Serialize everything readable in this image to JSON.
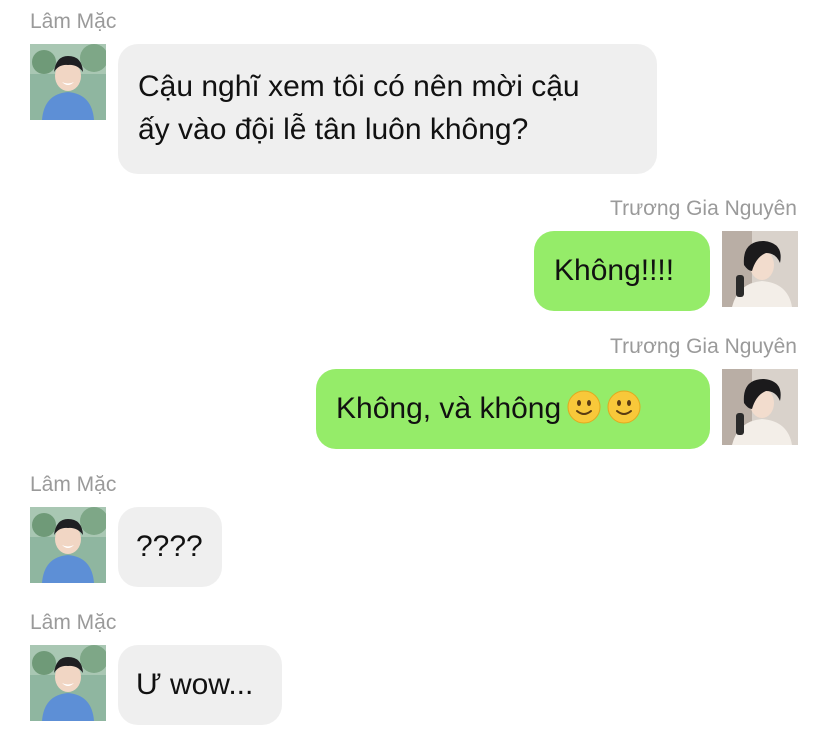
{
  "messages": [
    {
      "id": "m1",
      "direction": "in",
      "sender": "Lâm Mặc",
      "text": "Cậu nghĩ xem tôi có nên mời cậu\nấy vào đội lễ tân luôn không?"
    },
    {
      "id": "m2",
      "direction": "out",
      "sender": "Trương Gia Nguyên",
      "text": "Không!!!!"
    },
    {
      "id": "m3",
      "direction": "out",
      "sender": "Trương Gia Nguyên",
      "text": "Không, và không",
      "emojis": [
        "slightly-smiling-face",
        "slightly-smiling-face"
      ]
    },
    {
      "id": "m4",
      "direction": "in",
      "sender": "Lâm Mặc",
      "text": "????"
    },
    {
      "id": "m5",
      "direction": "in",
      "sender": "Lâm Mặc",
      "text": "Ư wow..."
    }
  ],
  "colors": {
    "incoming_bubble": "#efefef",
    "outgoing_bubble": "#95ec69",
    "sender_name": "#9a9a9a"
  }
}
